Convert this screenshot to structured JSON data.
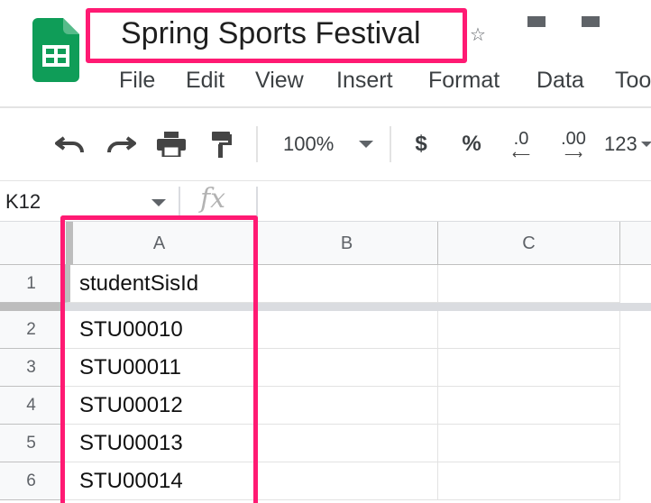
{
  "doc": {
    "title": "Spring Sports Festival"
  },
  "menu": [
    "File",
    "Edit",
    "View",
    "Insert",
    "Format",
    "Data",
    "Tools"
  ],
  "toolbar": {
    "zoom": "100%",
    "currency": "$",
    "percent": "%",
    "decrease_decimals": ".0",
    "increase_decimals": ".00",
    "more_formats": "123"
  },
  "formula_bar": {
    "name_box": "K12",
    "fx": "fx"
  },
  "grid": {
    "columns": [
      "A",
      "B",
      "C"
    ],
    "rows": [
      {
        "num": "1",
        "a": "studentSisId"
      },
      {
        "num": "2",
        "a": "STU00010"
      },
      {
        "num": "3",
        "a": "STU00011"
      },
      {
        "num": "4",
        "a": "STU00012"
      },
      {
        "num": "5",
        "a": "STU00013"
      },
      {
        "num": "6",
        "a": "STU00014"
      }
    ]
  },
  "colors": {
    "highlight": "#ff1a73",
    "sheets_green": "#0f9d58"
  },
  "icons": [
    "sheets-logo-icon",
    "star-icon",
    "undo-icon",
    "redo-icon",
    "print-icon",
    "paint-format-icon",
    "chevron-down-icon"
  ]
}
